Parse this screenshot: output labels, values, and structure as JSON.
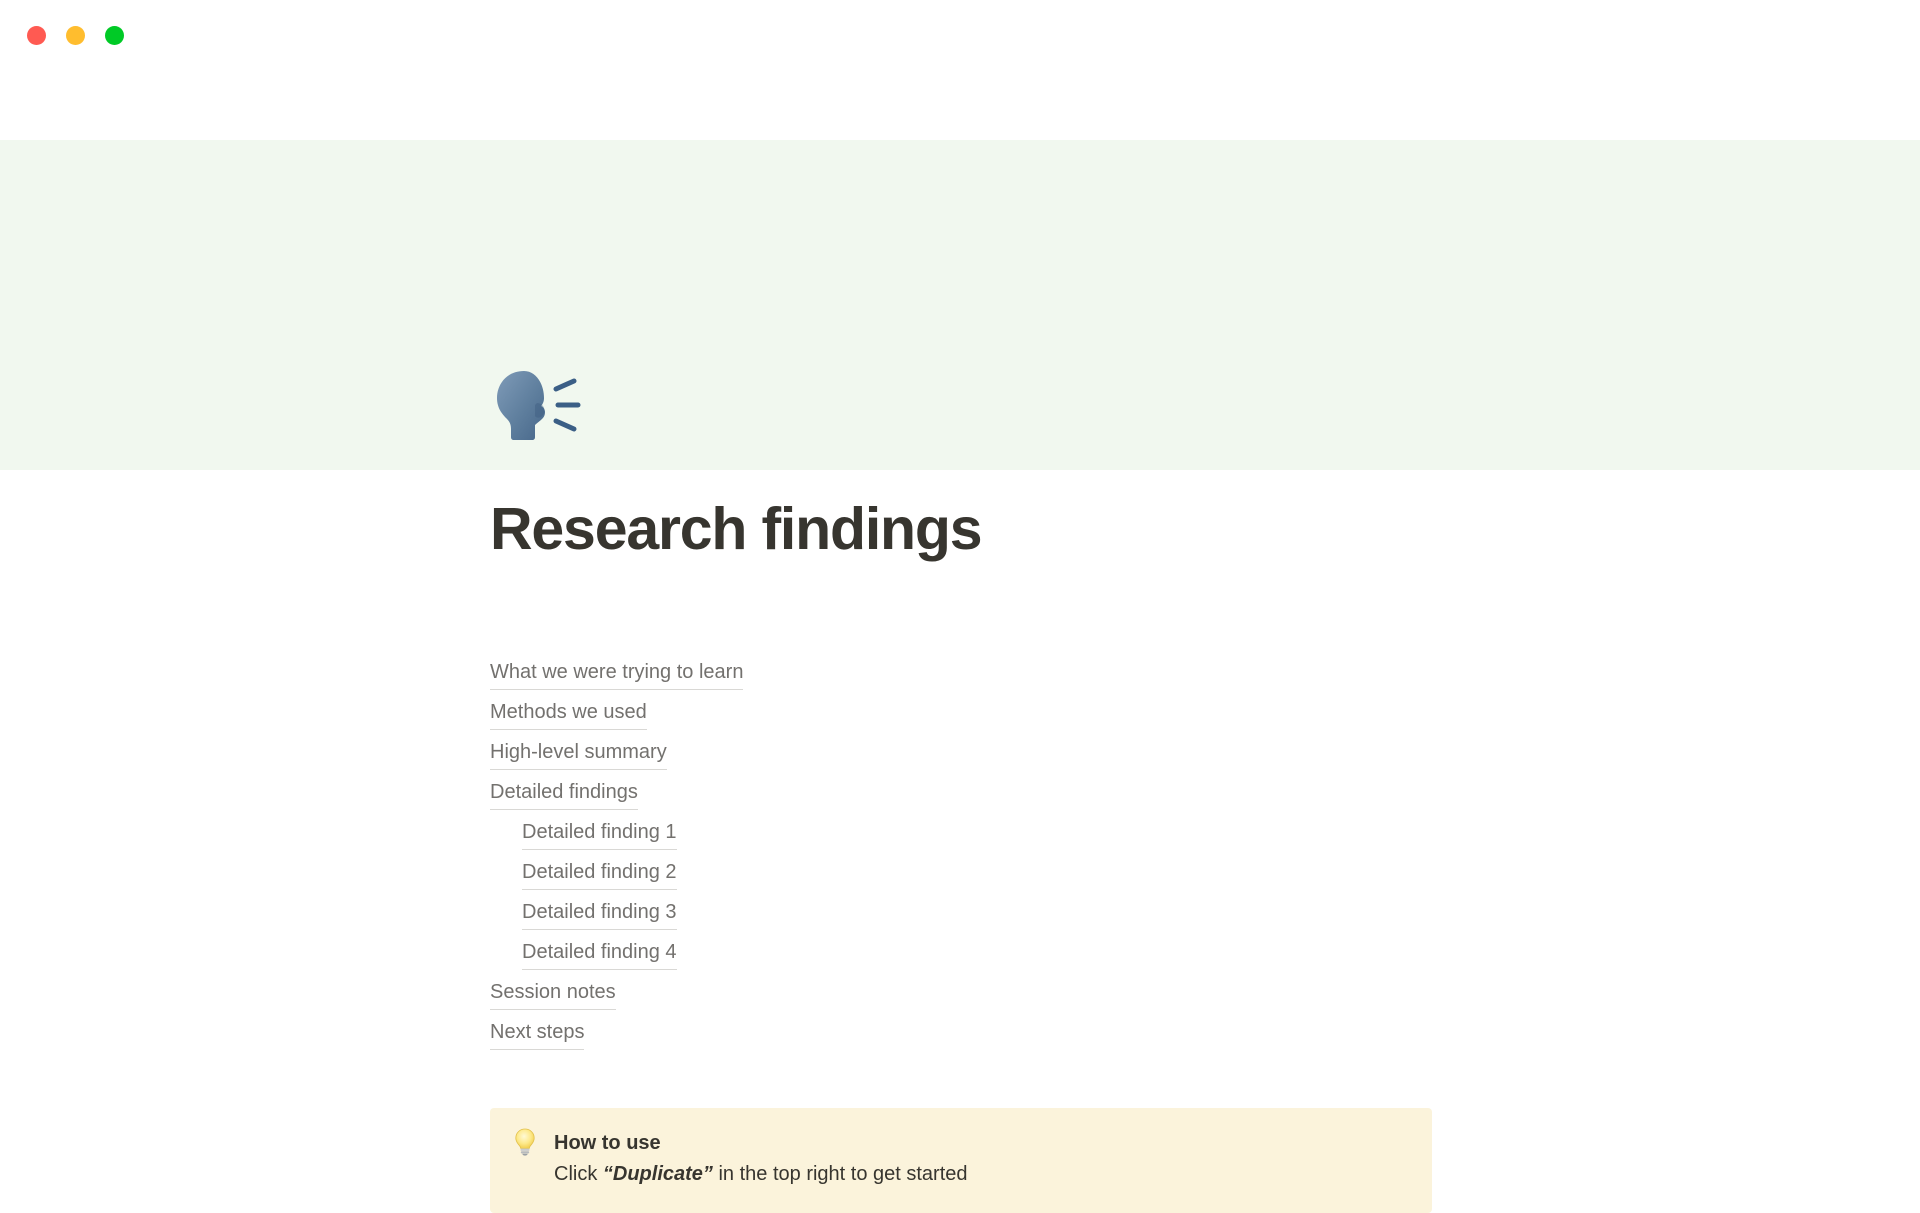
{
  "window": {
    "controls": [
      {
        "name": "close",
        "label": "Close",
        "color": "#ff5a52"
      },
      {
        "name": "minimize",
        "label": "Minimize",
        "color": "#ffbd2e"
      },
      {
        "name": "maximize",
        "label": "Maximize",
        "color": "#00ca26"
      }
    ]
  },
  "cover": {
    "color": "#f1f8ef"
  },
  "page": {
    "icon": "speaking-head-emoji",
    "icon_glyph": "🗣️",
    "title": "Research findings",
    "title_color": "#37352f"
  },
  "toc": {
    "items": [
      {
        "label": "What we were trying to learn",
        "level": 1
      },
      {
        "label": "Methods we used",
        "level": 1
      },
      {
        "label": "High-level summary",
        "level": 1
      },
      {
        "label": "Detailed findings",
        "level": 1
      },
      {
        "label": "Detailed finding 1",
        "level": 2
      },
      {
        "label": "Detailed finding 2",
        "level": 2
      },
      {
        "label": "Detailed finding 3",
        "level": 2
      },
      {
        "label": "Detailed finding 4",
        "level": 2
      },
      {
        "label": "Session notes",
        "level": 1
      },
      {
        "label": "Next steps",
        "level": 1
      }
    ]
  },
  "callout": {
    "icon": "light-bulb-emoji",
    "icon_glyph": "💡",
    "background": "#fbf3db",
    "title": "How to use",
    "text_before": "Click ",
    "text_emphasis": "“Duplicate”",
    "text_after": " in the top right to get started",
    "text_full": "Click “Duplicate” in the top right to get started"
  }
}
